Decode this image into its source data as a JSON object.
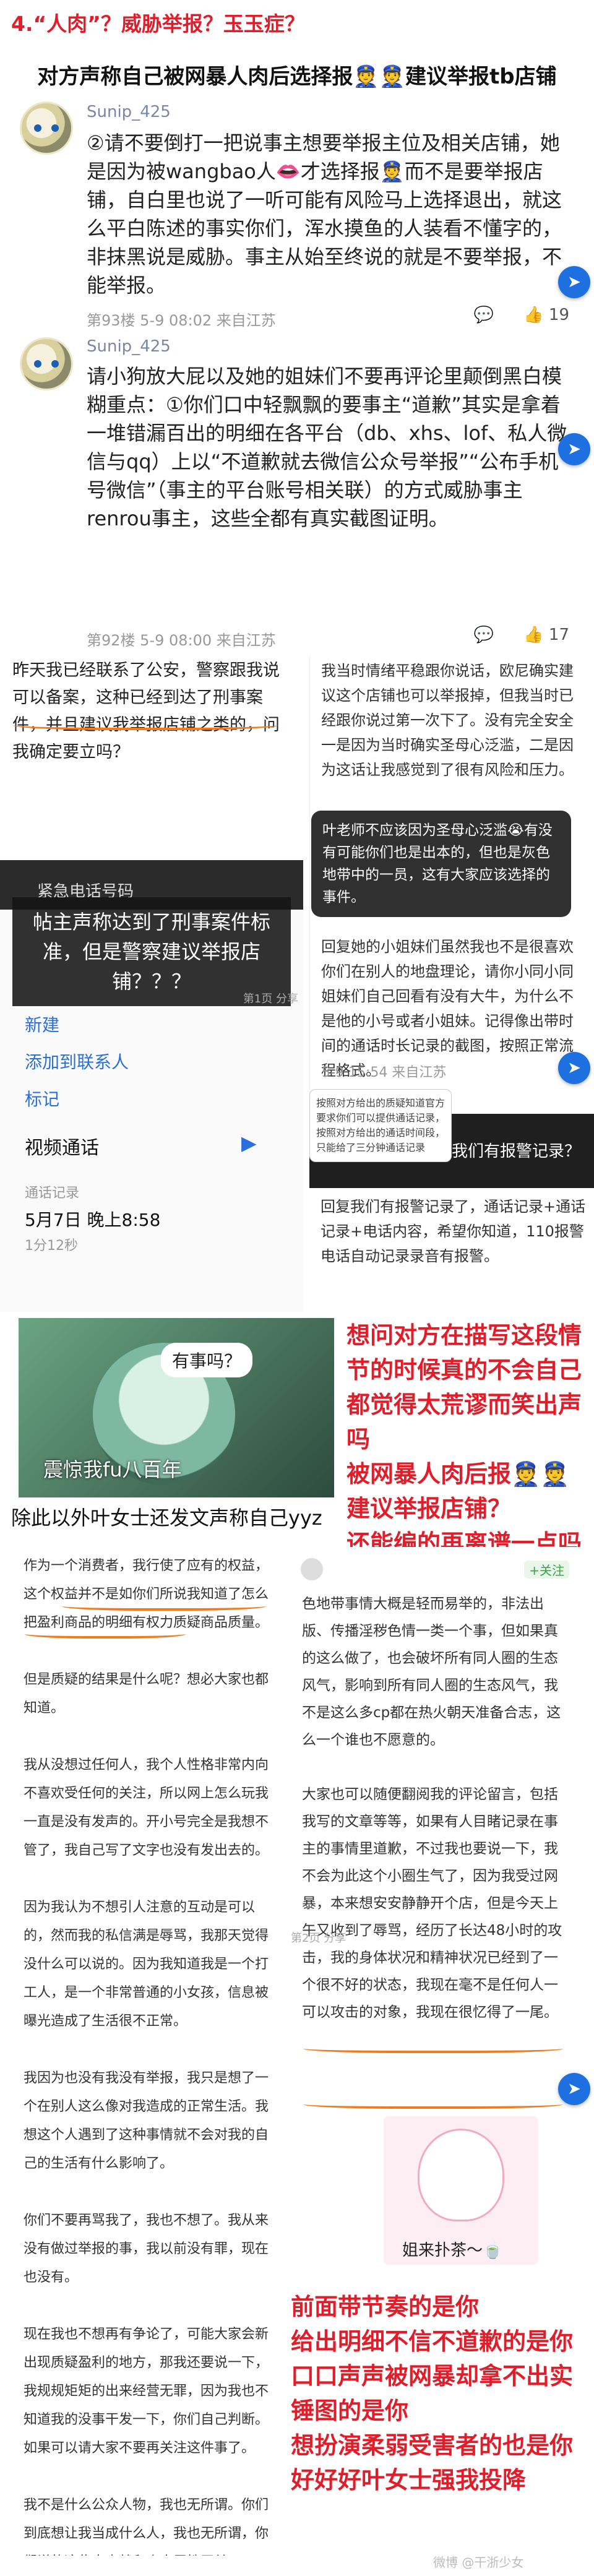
{
  "title": "4.“人肉”？威胁举报？玉玉症？",
  "subtitle": "对方声称自己被网暴人肉后选择报👮👮建议举报tb店铺",
  "comments": [
    {
      "username": "Sunip_425",
      "text": "②请不要倒打一把说事主想要举报主位及相关店铺，她是因为被wangbao人👄才选择报👮而不是要举报店铺，自白里也说了一听可能有风险马上选择退出，就这么平白陈述的事实你们，浑水摸鱼的人装看不懂字的，非抹黑说是威胁。事主从始至终说的就是不要举报，不能举报。",
      "meta": "第93楼  5-9 08:02  来自江苏",
      "likes": "19"
    },
    {
      "username": "Sunip_425",
      "text": "请小狗放大屁以及她的姐妹们不要再评论里颠倒黑白模糊重点：①你们口中轻飘飘的要事主“道歉”其实是拿着一堆错漏百出的明细在各平台（db、xhs、lof、私人微信与qq）上以“不道歉就去微信公众号举报”“公布手机号微信”（事主的平台账号相关联）的方式威胁事主renrou事主，这些全都有真实截图证明。",
      "meta": "第92楼  5-9 08:00  来自江苏",
      "likes": "17"
    }
  ],
  "chat_left": {
    "text": "昨天我已经联系了公安，警察跟我说可以备案，这种已经到达了刑事案件，并且建议我举报店铺之类的，问我确定要立吗？"
  },
  "chat_right": {
    "text": "我当时情绪平稳跟你说话，欧尼确实建议这个店铺也可以举报掉，但我当时已经跟你说过第一次下了。没有完全安全一是因为当时确实圣母心泛滥，二是因为这话让我感觉到了很有风险和压力。",
    "toast": "叶老师不应该因为圣母心泛滥😭有没有可能你们也是出本的，但也是灰色地带中的一员，这有大家应该选择的事件。",
    "reply_text": "回复她的小姐妹们虽然我也不是很喜欢你们在别人的地盘理论，请你小同小同姐妹们自己回看有没有大牛，为什么不是他的小号或者小姐妹。记得像出带时间的通话时长记录的截图，按照正常流程格式。",
    "meta": "5-9 15:54  来自江苏",
    "report_title": "我们有报警记录？",
    "report_text": "回复我们有报警记录了，通话记录+通话记录+电话内容，希望你知道，110报警电话自动记录录音有报警。",
    "small_popup": "按照对方给出的质疑知道官方要求你们可以提供通话记录，按照对方给出的通话时间段，只能给了三分钟通话记录"
  },
  "phone_screen": {
    "top_label": "紧急电话号码",
    "overlay": "帖主声称达到了刑事案件标准，但是警察建议举报店铺？？？",
    "new": "新建",
    "add_contact": "添加到联系人",
    "tag": "标记",
    "video_call": "视频通话",
    "call_log": "通话记录",
    "call_date": "5月7日 晚上8:58",
    "call_dur": "1分12秒",
    "page_marker": "第1页 分享"
  },
  "meme1": {
    "bubble": "有事吗？",
    "caption": "震惊我fu八百年"
  },
  "red_note1": "想问对方在描写这段情节的时候真的不会自己都觉得太荒谬而笑出声吗\n被网暴人肉后报👮👮建议举报店铺？\n还能编的再离谱一点吗",
  "section2": "除此以外叶女士还发文声称自己yyz",
  "doc_left": "作为一个消费者，我行使了应有的权益，这个权益并不是如你们所说我知道了怎么把盈利商品的明细有权力质疑商品质量。\n\n但是质疑的结果是什么呢？想必大家也都知道。\n\n我从没想过任何人，我个人性格非常内向不喜欢受任何的关注，所以网上怎么玩我一直是没有发声的。开小号完全是我想不管了，我自己写了文字也没有发出去的。\n\n因为我认为不想引人注意的互动是可以的，然而我的私信满是辱骂，我那天觉得没什么可以说的。因为我知道我是一个打工人，是一个非常普通的小女孩，信息被曝光造成了生活很不正常。\n\n我因为也没有我没有举报，我只是想了一个在别人这么像对我造成的正常生活。我想这个人遇到了这种事情就不会对我的自己的生活有什么影响了。\n\n你们不要再骂我了，我也不想了。我从来没有做过举报的事，我以前没有罪，现在也没有。\n\n现在我也不想再有争论了，可能大家会新出现质疑盈利的地方，那我还要说一下，我规规矩矩的出来经营无罪，因为我也不知道我的没事干发一下，你们自己判断。如果可以请大家不要再关注这件事了。\n\n我不是什么公众人物，我也无所谓。你们到底想让我当成什么人，我也无所谓，你们说的这些事本就和个人属性无关。",
  "doc_right": {
    "follow": "+关注",
    "body": "色地带事情大概是轻而易举的，非法出版、传播淫秽色情一类一个事，但如果真的这么做了，也会破坏所有同人圈的生态风气，影响到所有同人圈的生态风气，我不是这么多cp都在热火朝天准备合志，这么一个谁也不愿意的。\n\n大家也可以随便翻阅我的评论留言，包括我写的文章等等，如果有人目睹记录在事主的事情里道歉，不过我也要说一下，我不会为此这个小圈生气了，因为我受过网暴，本来想安安静静开个店，但是今天上午又收到了辱骂，经历了长达48小时的攻击，我的身体状况和精神状况已经到了一个很不好的状态，我现在毫不是任何人一可以攻击的对象，我现在很忆得了一尾。",
    "page_marker": "第2页 分享"
  },
  "meme2": {
    "caption": "姐来扑茶～🍵"
  },
  "red_note2": "前面带节奏的是你\n给出明细不信不道歉的是你\n口口声声被网暴却拿不出实锤图的是你\n想扮演柔弱受害者的也是你\n好好好叶女士强我投降",
  "watermark": "微博 @干浙少女"
}
